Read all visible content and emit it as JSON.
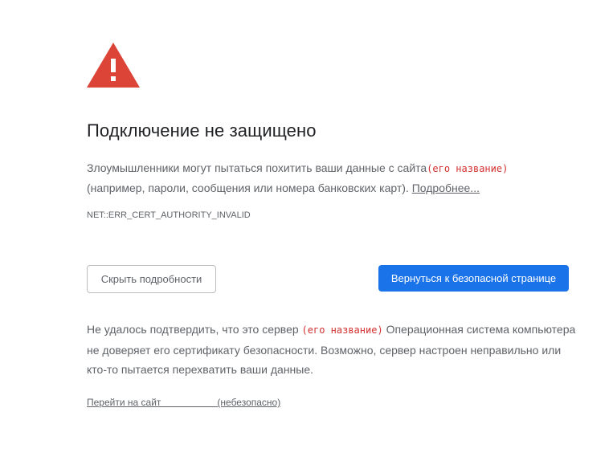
{
  "title": "Подключение не защищено",
  "message": {
    "text_before": "Злоумышленники могут пытаться похитить ваши данные с сайта",
    "site_name": "(его название)",
    "text_after": "(например, пароли, сообщения или номера банковских карт).",
    "learn_more": "Подробнее..."
  },
  "error_code": "NET::ERR_CERT_AUTHORITY_INVALID",
  "buttons": {
    "details": "Скрыть подробности",
    "back_to_safety": "Вернуться к безопасной странице"
  },
  "details": {
    "text_before": "Не удалось подтвердить, что это сервер",
    "site_name": "(его название)",
    "text_after": "Операционная система компьютера не доверяет его сертификату безопасности. Возможно, сервер настроен неправильно или кто-то пытается перехватить ваши данные."
  },
  "proceed_link": "Перейти на сайт                     (небезопасно)",
  "colors": {
    "warning_red": "#db4437",
    "primary_blue": "#1a73e8",
    "annotation_red": "#d32f2f"
  }
}
